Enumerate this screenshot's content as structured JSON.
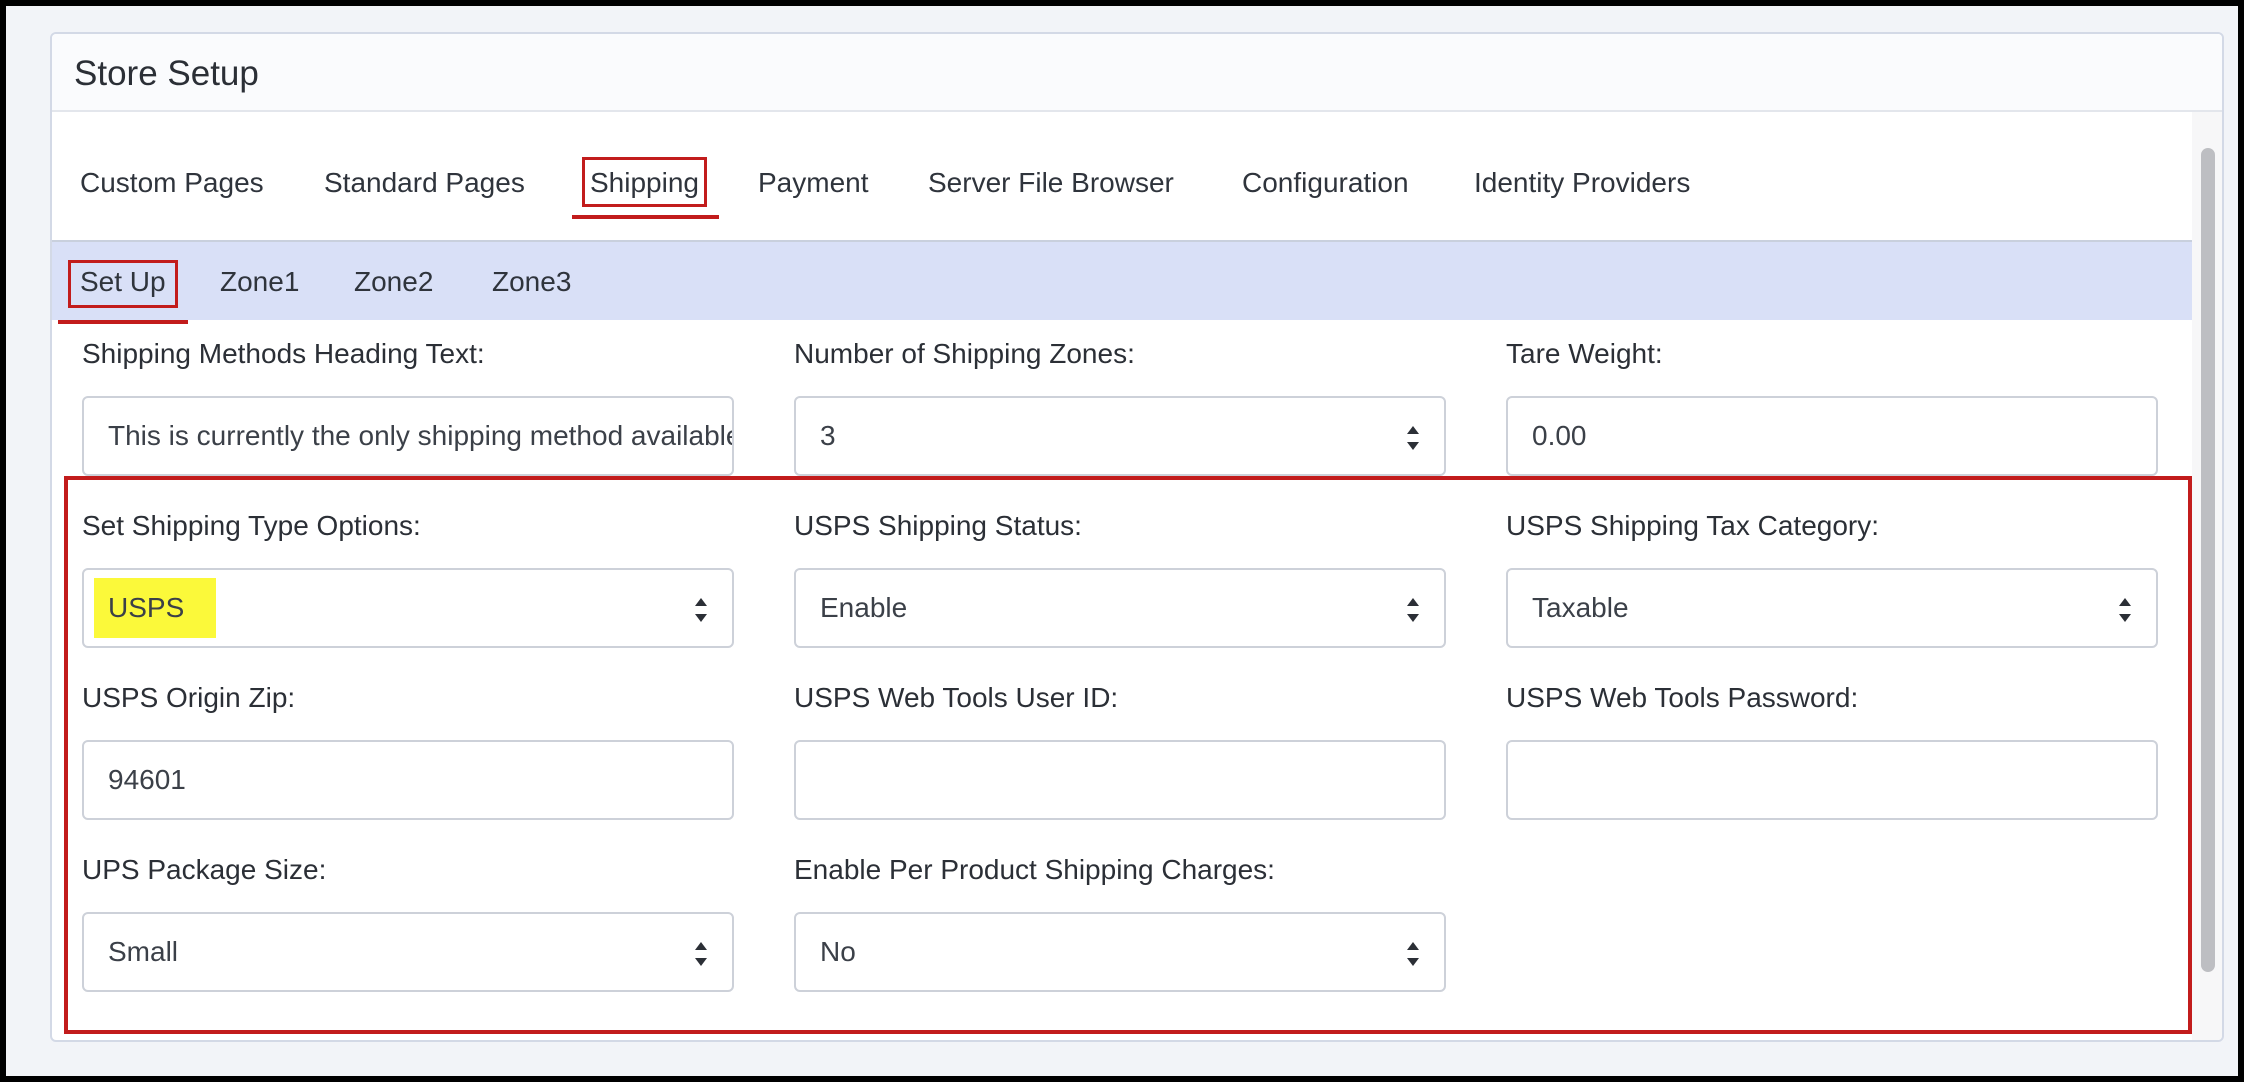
{
  "panel": {
    "title": "Store Setup"
  },
  "tabs": [
    {
      "label": "Custom Pages"
    },
    {
      "label": "Standard Pages"
    },
    {
      "label": "Shipping"
    },
    {
      "label": "Payment"
    },
    {
      "label": "Server File Browser"
    },
    {
      "label": "Configuration"
    },
    {
      "label": "Identity Providers"
    }
  ],
  "subtabs": [
    {
      "label": "Set Up"
    },
    {
      "label": "Zone1"
    },
    {
      "label": "Zone2"
    },
    {
      "label": "Zone3"
    }
  ],
  "active_tab": "Shipping",
  "active_subtab": "Set Up",
  "fields": {
    "heading_text": {
      "label": "Shipping Methods Heading Text:",
      "value": "This is currently the only shipping method available"
    },
    "num_zones": {
      "label": "Number of Shipping Zones:",
      "value": "3"
    },
    "tare_weight": {
      "label": "Tare Weight:",
      "value": "0.00"
    },
    "shipping_type": {
      "label": "Set Shipping Type Options:",
      "value": "USPS"
    },
    "usps_status": {
      "label": "USPS Shipping Status:",
      "value": "Enable"
    },
    "usps_tax": {
      "label": "USPS Shipping Tax Category:",
      "value": "Taxable"
    },
    "usps_zip": {
      "label": "USPS Origin Zip:",
      "value": "94601"
    },
    "usps_user_id": {
      "label": "USPS Web Tools User ID:",
      "value": ""
    },
    "usps_password": {
      "label": "USPS Web Tools Password:",
      "value": ""
    },
    "ups_package_size": {
      "label": "UPS Package Size:",
      "value": "Small"
    },
    "per_product_charges": {
      "label": "Enable Per Product Shipping Charges:",
      "value": "No"
    }
  },
  "colors": {
    "highlight_red": "#c21c1c",
    "highlight_yellow": "#fbf93a",
    "subtab_bg": "#d9e0f7"
  }
}
